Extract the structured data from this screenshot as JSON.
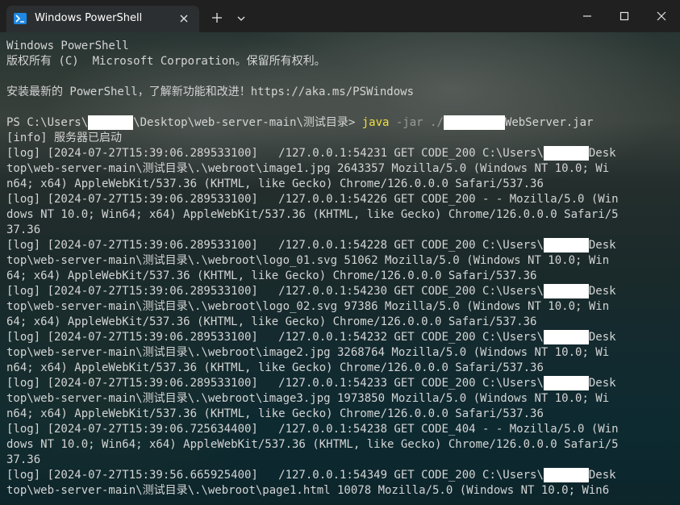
{
  "window": {
    "tab_title": "Windows PowerShell",
    "new_tab_label": "+",
    "icons": [
      "powershell-icon",
      "close-icon",
      "plus-icon",
      "chevron-down-icon",
      "minimize-icon",
      "maximize-icon",
      "close-window-icon"
    ]
  },
  "terminal": {
    "header": [
      "Windows PowerShell",
      "版权所有 (C)  Microsoft Corporation。保留所有权利。",
      "",
      "安装最新的 PowerShell，了解新功能和改进！https://aka.ms/PSWindows",
      ""
    ],
    "prompt": {
      "prefix": "PS C:\\Users\\",
      "suffix": "\\Desktop\\web-server-main\\测试目录> ",
      "command": "java",
      "args": " -jar ./",
      "jar_name": "WebServer.jar"
    },
    "output": [
      "[info] 服务器已启动",
      "[log] [2024-07-27T15:39:06.289533100]   /127.0.0.1:54231 GET CODE_200 C:\\Users\\",
      "top\\web-server-main\\测试目录\\.\\webroot\\image1.jpg 2643357 Mozilla/5.0 (Windows NT 10.0; Wi",
      "n64; x64) AppleWebKit/537.36 (KHTML, like Gecko) Chrome/126.0.0.0 Safari/537.36",
      "[log] [2024-07-27T15:39:06.289533100]   /127.0.0.1:54226 GET CODE_200 - - Mozilla/5.0 (Win",
      "dows NT 10.0; Win64; x64) AppleWebKit/537.36 (KHTML, like Gecko) Chrome/126.0.0.0 Safari/5",
      "37.36",
      "[log] [2024-07-27T15:39:06.289533100]   /127.0.0.1:54228 GET CODE_200 C:\\Users\\",
      "top\\web-server-main\\测试目录\\.\\webroot\\logo_01.svg 51062 Mozilla/5.0 (Windows NT 10.0; Win",
      "64; x64) AppleWebKit/537.36 (KHTML, like Gecko) Chrome/126.0.0.0 Safari/537.36",
      "[log] [2024-07-27T15:39:06.289533100]   /127.0.0.1:54230 GET CODE_200 C:\\Users\\",
      "top\\web-server-main\\测试目录\\.\\webroot\\logo_02.svg 97386 Mozilla/5.0 (Windows NT 10.0; Win",
      "64; x64) AppleWebKit/537.36 (KHTML, like Gecko) Chrome/126.0.0.0 Safari/537.36",
      "[log] [2024-07-27T15:39:06.289533100]   /127.0.0.1:54232 GET CODE_200 C:\\Users\\",
      "top\\web-server-main\\测试目录\\.\\webroot\\image2.jpg 3268764 Mozilla/5.0 (Windows NT 10.0; Wi",
      "n64; x64) AppleWebKit/537.36 (KHTML, like Gecko) Chrome/126.0.0.0 Safari/537.36",
      "[log] [2024-07-27T15:39:06.289533100]   /127.0.0.1:54233 GET CODE_200 C:\\Users\\",
      "top\\web-server-main\\测试目录\\.\\webroot\\image3.jpg 1973850 Mozilla/5.0 (Windows NT 10.0; Wi",
      "n64; x64) AppleWebKit/537.36 (KHTML, like Gecko) Chrome/126.0.0.0 Safari/537.36",
      "[log] [2024-07-27T15:39:06.725634400]   /127.0.0.1:54238 GET CODE_404 - - Mozilla/5.0 (Win",
      "dows NT 10.0; Win64; x64) AppleWebKit/537.36 (KHTML, like Gecko) Chrome/126.0.0.0 Safari/5",
      "37.36",
      "[log] [2024-07-27T15:39:56.665925400]   /127.0.0.1:54349 GET CODE_200 C:\\Users\\",
      "top\\web-server-main\\测试目录\\.\\webroot\\page1.html 10078 Mozilla/5.0 (Windows NT 10.0; Win6"
    ],
    "desk_suffix": "Desk",
    "redacted_lines": [
      1,
      7,
      10,
      13,
      16,
      22
    ]
  },
  "colors": {
    "text": "#d4d4d4",
    "command": "#f3df3a",
    "args": "#9b9b9b",
    "titlebar": "#202020",
    "tab": "#2c2f31",
    "redaction": "#ffffff"
  }
}
